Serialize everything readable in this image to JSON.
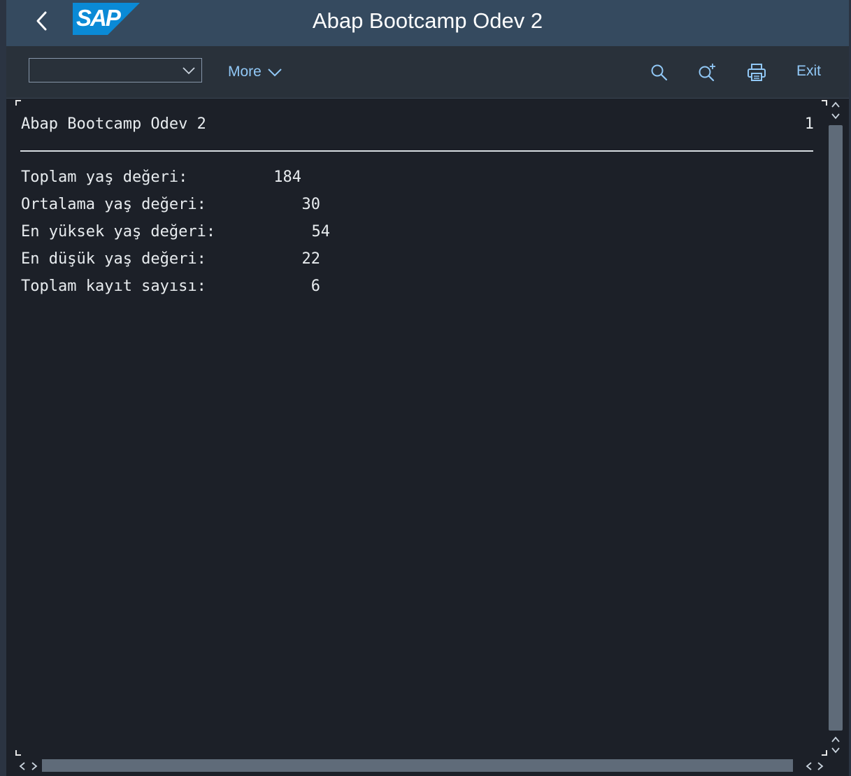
{
  "window": {
    "title": "Abap Bootcamp Odev 2"
  },
  "shell": {
    "logo_text": "SAP",
    "back_icon": "chevron-left-icon"
  },
  "toolbar": {
    "command_field_value": "",
    "more_label": "More",
    "icons": [
      "search-icon",
      "search-next-icon",
      "print-icon"
    ],
    "exit_label": "Exit"
  },
  "report": {
    "title": "Abap Bootcamp Odev 2",
    "page_number": "1",
    "rows": [
      {
        "label": "Toplam yaş değeri:",
        "value": "184"
      },
      {
        "label": "Ortalama yaş değeri:",
        "value": "30"
      },
      {
        "label": "En yüksek yaş değeri:",
        "value": "54"
      },
      {
        "label": "En düşük yaş değeri:",
        "value": "22"
      },
      {
        "label": "Toplam kayıt sayısı:",
        "value": "6"
      }
    ]
  },
  "colors": {
    "shell_bg": "#354a5f",
    "toolbar_bg": "#29313a",
    "content_bg": "#1c2028",
    "accent": "#91c8f6",
    "logo_blue": "#0a8ad6"
  }
}
